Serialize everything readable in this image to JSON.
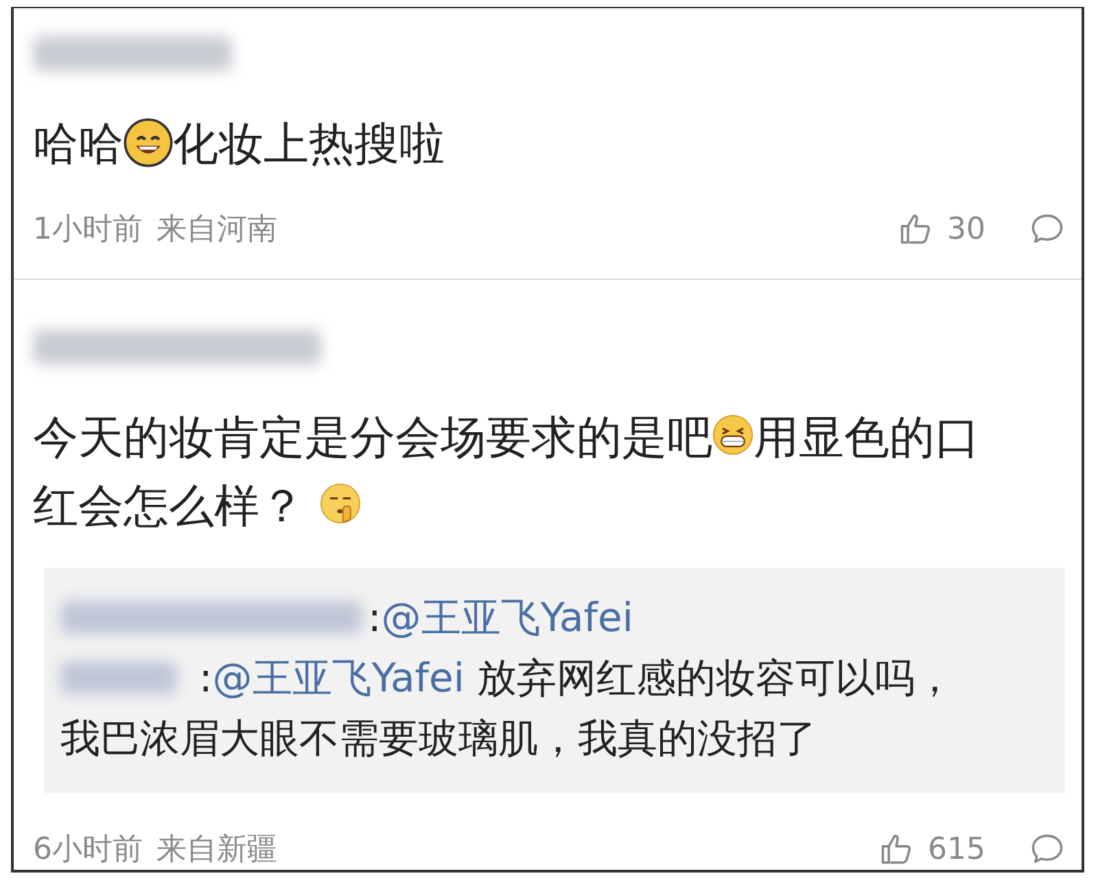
{
  "comments": [
    {
      "content": [
        {
          "kind": "text",
          "text": "哈哈"
        },
        {
          "kind": "smile"
        },
        {
          "kind": "text",
          "text": "化妆上热搜啦"
        }
      ],
      "time": "1小时前",
      "location": "来自河南",
      "likes": "30"
    },
    {
      "content": [
        {
          "kind": "text",
          "text": "今天的妆肯定是分会场要求的是吧"
        },
        {
          "kind": "grin"
        },
        {
          "kind": "text",
          "text": "用显色的口红会怎么样？ "
        },
        {
          "kind": "shush"
        }
      ],
      "time": "6小时前",
      "location": "来自新疆",
      "likes": "615",
      "replies": [
        {
          "separator": ":",
          "mention": "@王亚飞Yafei"
        },
        {
          "separator": ":",
          "mention": "@王亚飞Yafei",
          "text": " 放弃网红感的妆容可以吗，我巴浓眉大眼不需要玻璃肌，我真的没招了"
        }
      ]
    }
  ]
}
